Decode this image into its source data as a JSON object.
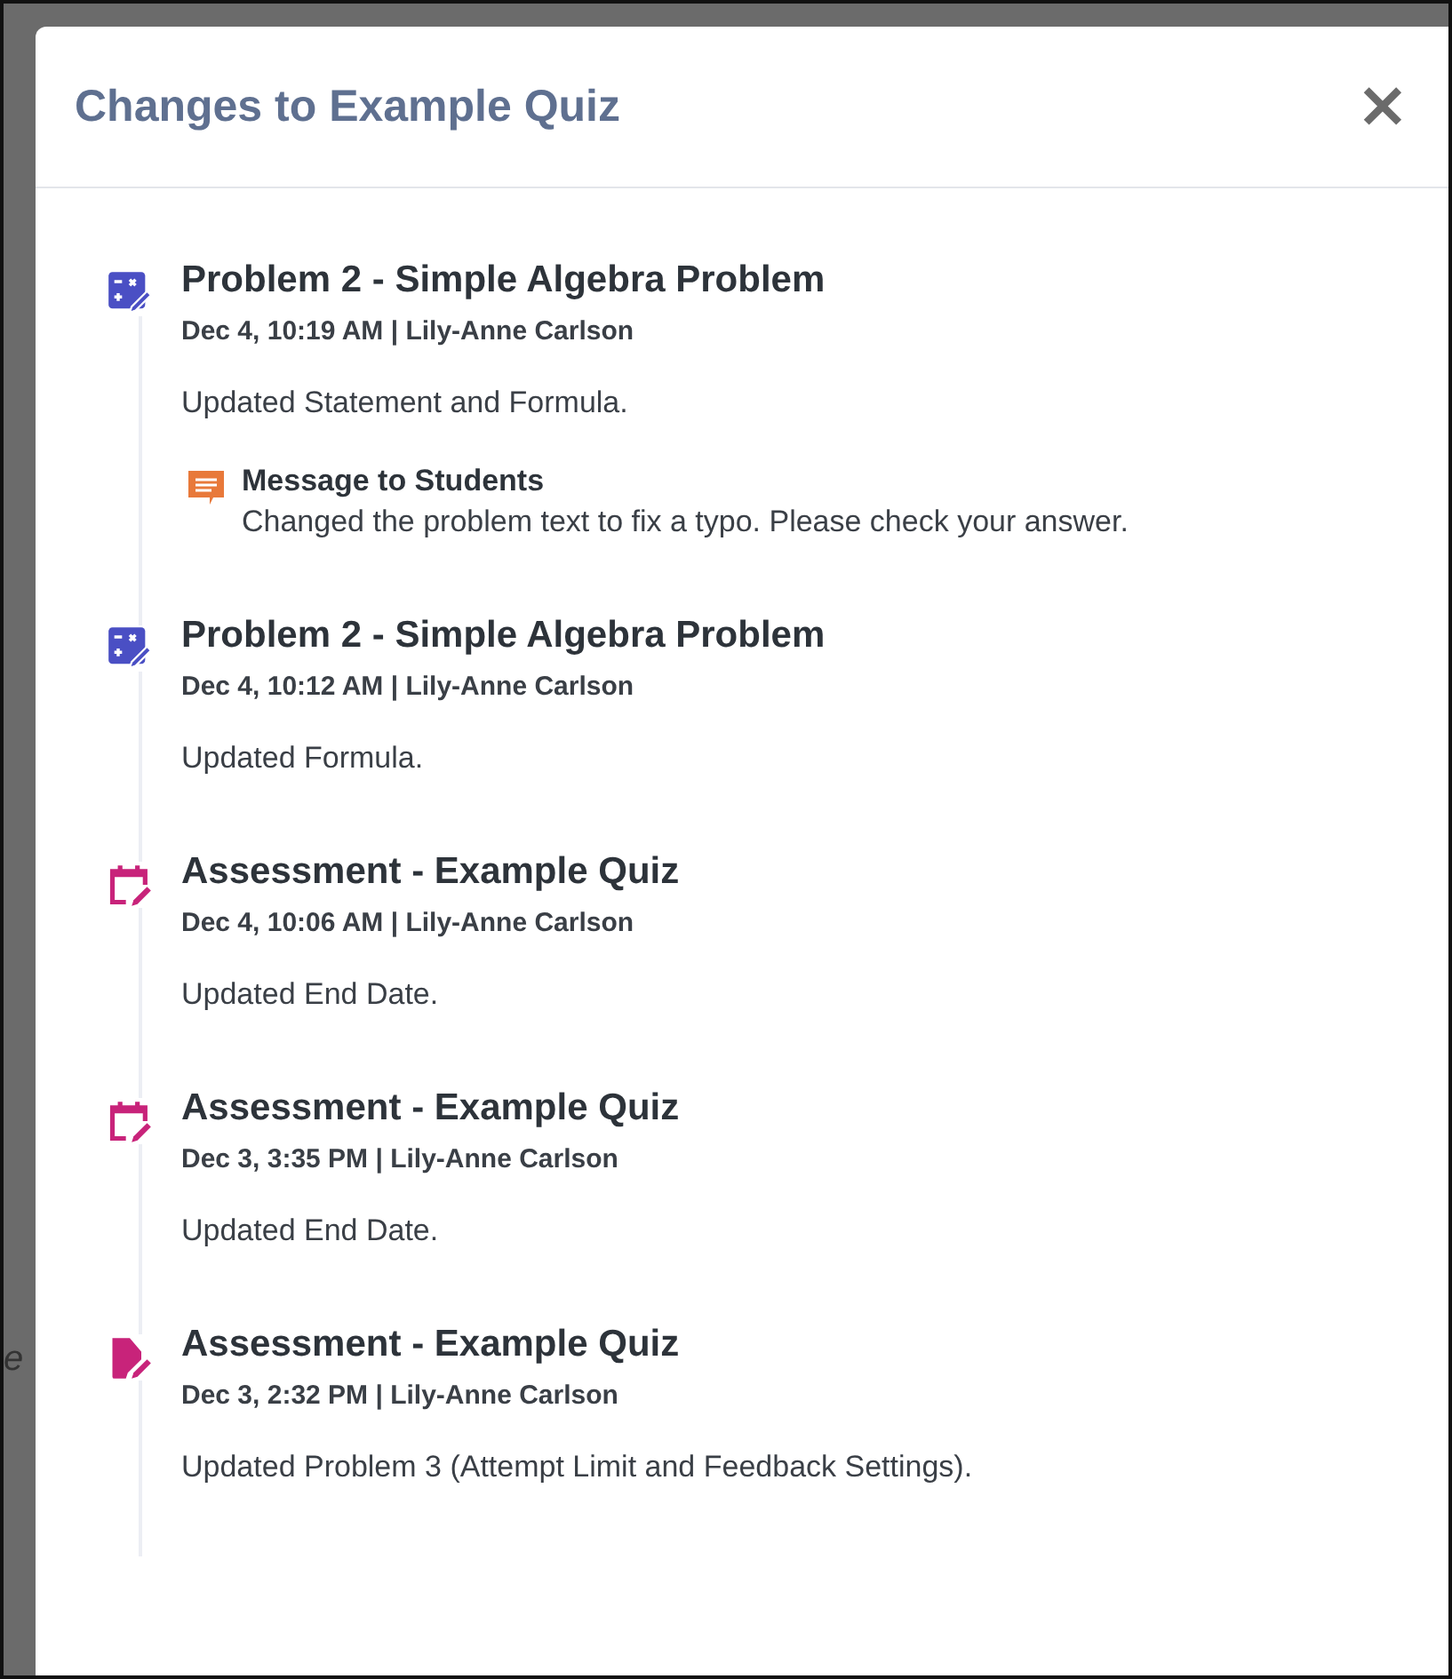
{
  "backdrop_text": "e",
  "dialog": {
    "title": "Changes to Example Quiz",
    "close": "×"
  },
  "changes": [
    {
      "kind": "problem",
      "title": "Problem 2 - Simple Algebra Problem",
      "meta": "Dec 4, 10:19 AM | Lily-Anne Carlson",
      "description": "Updated Statement and Formula.",
      "message": {
        "title": "Message to Students",
        "text": "Changed the problem text to fix a typo. Please check your answer."
      }
    },
    {
      "kind": "problem",
      "title": "Problem 2 - Simple Algebra Problem",
      "meta": "Dec 4, 10:12 AM | Lily-Anne Carlson",
      "description": "Updated Formula."
    },
    {
      "kind": "date",
      "title": "Assessment - Example Quiz",
      "meta": "Dec 4, 10:06 AM | Lily-Anne Carlson",
      "description": "Updated End Date."
    },
    {
      "kind": "date",
      "title": "Assessment - Example Quiz",
      "meta": "Dec 3, 3:35 PM | Lily-Anne Carlson",
      "description": "Updated End Date."
    },
    {
      "kind": "settings",
      "title": "Assessment - Example Quiz",
      "meta": "Dec 3, 2:32 PM | Lily-Anne Carlson",
      "description": "Updated Problem 3 (Attempt Limit and Feedback Settings)."
    }
  ]
}
